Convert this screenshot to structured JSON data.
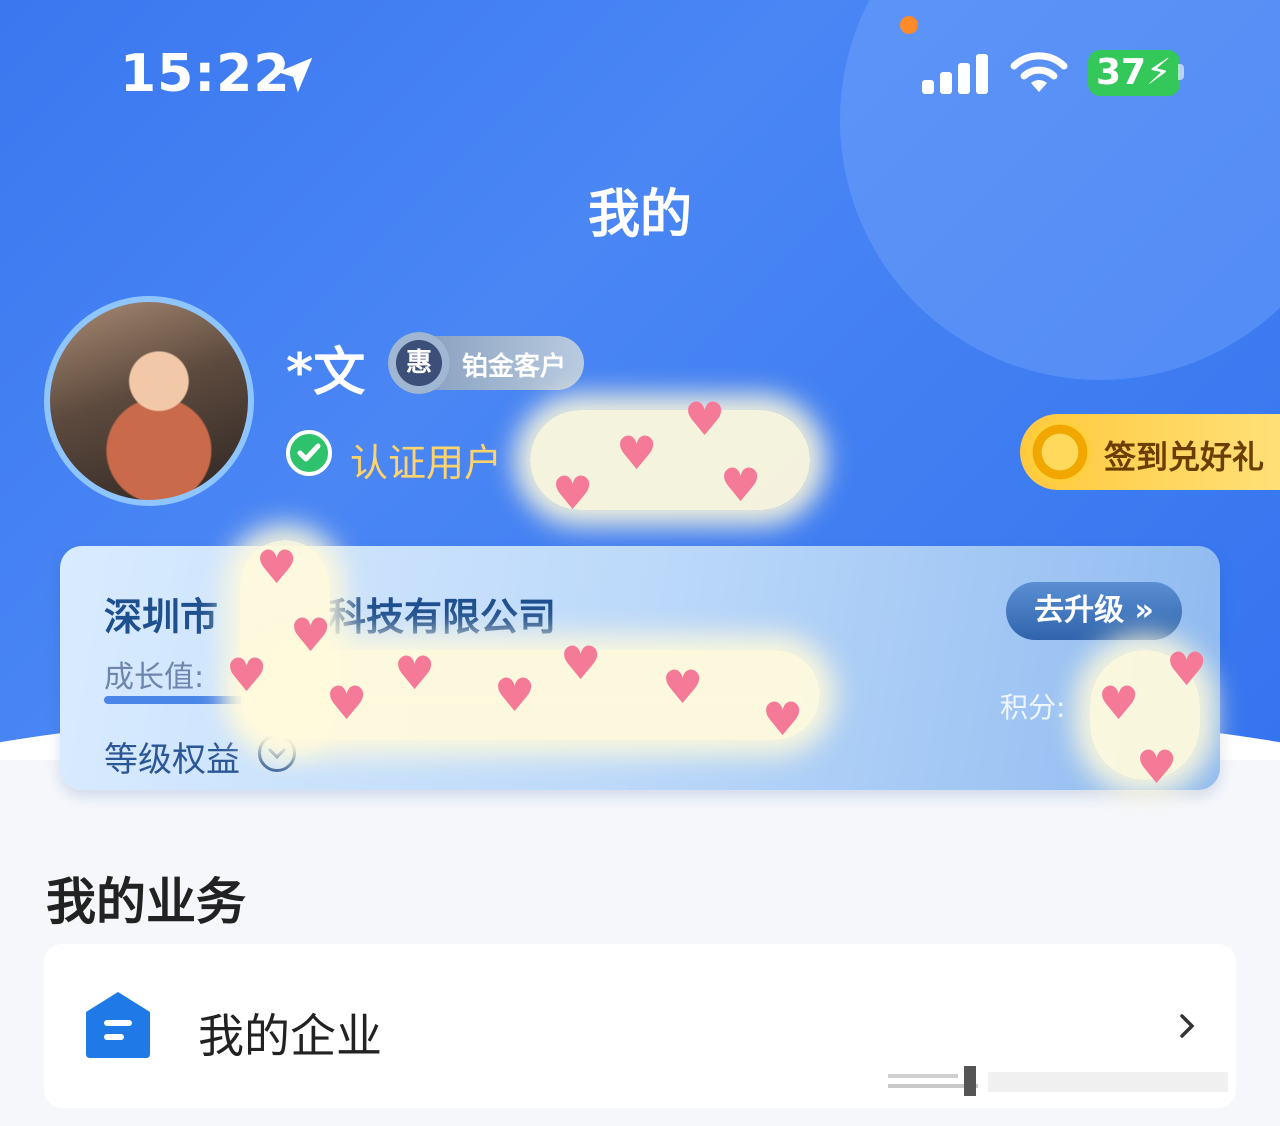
{
  "status": {
    "time": "15:22",
    "battery": "37"
  },
  "header": {
    "title": "我的"
  },
  "profile": {
    "name": "*文",
    "vip_medal": "惠",
    "vip_label": "铂金客户",
    "verified_label": "认证用户",
    "signin_label": "签到兑好礼"
  },
  "member_card": {
    "company": "深圳市",
    "company_tail": "科技有限公司",
    "upgrade_label": "去升级 »",
    "growth_label": "成长值:",
    "points_label": "积分:",
    "benefits_label": "等级权益"
  },
  "business": {
    "section_title": "我的业务",
    "items": [
      {
        "label": "我的企业"
      }
    ]
  },
  "colors": {
    "hero_blue": "#3a78f0",
    "verified_gold": "#ffd36b",
    "signin_gold": "#ffc93d",
    "company_blue": "#1e4f8f"
  },
  "icons": [
    "location-arrow-icon",
    "signal-icon",
    "wifi-icon",
    "battery-icon",
    "check-icon",
    "coin-icon",
    "chevron-down-icon",
    "building-icon",
    "chevron-right-icon"
  ]
}
